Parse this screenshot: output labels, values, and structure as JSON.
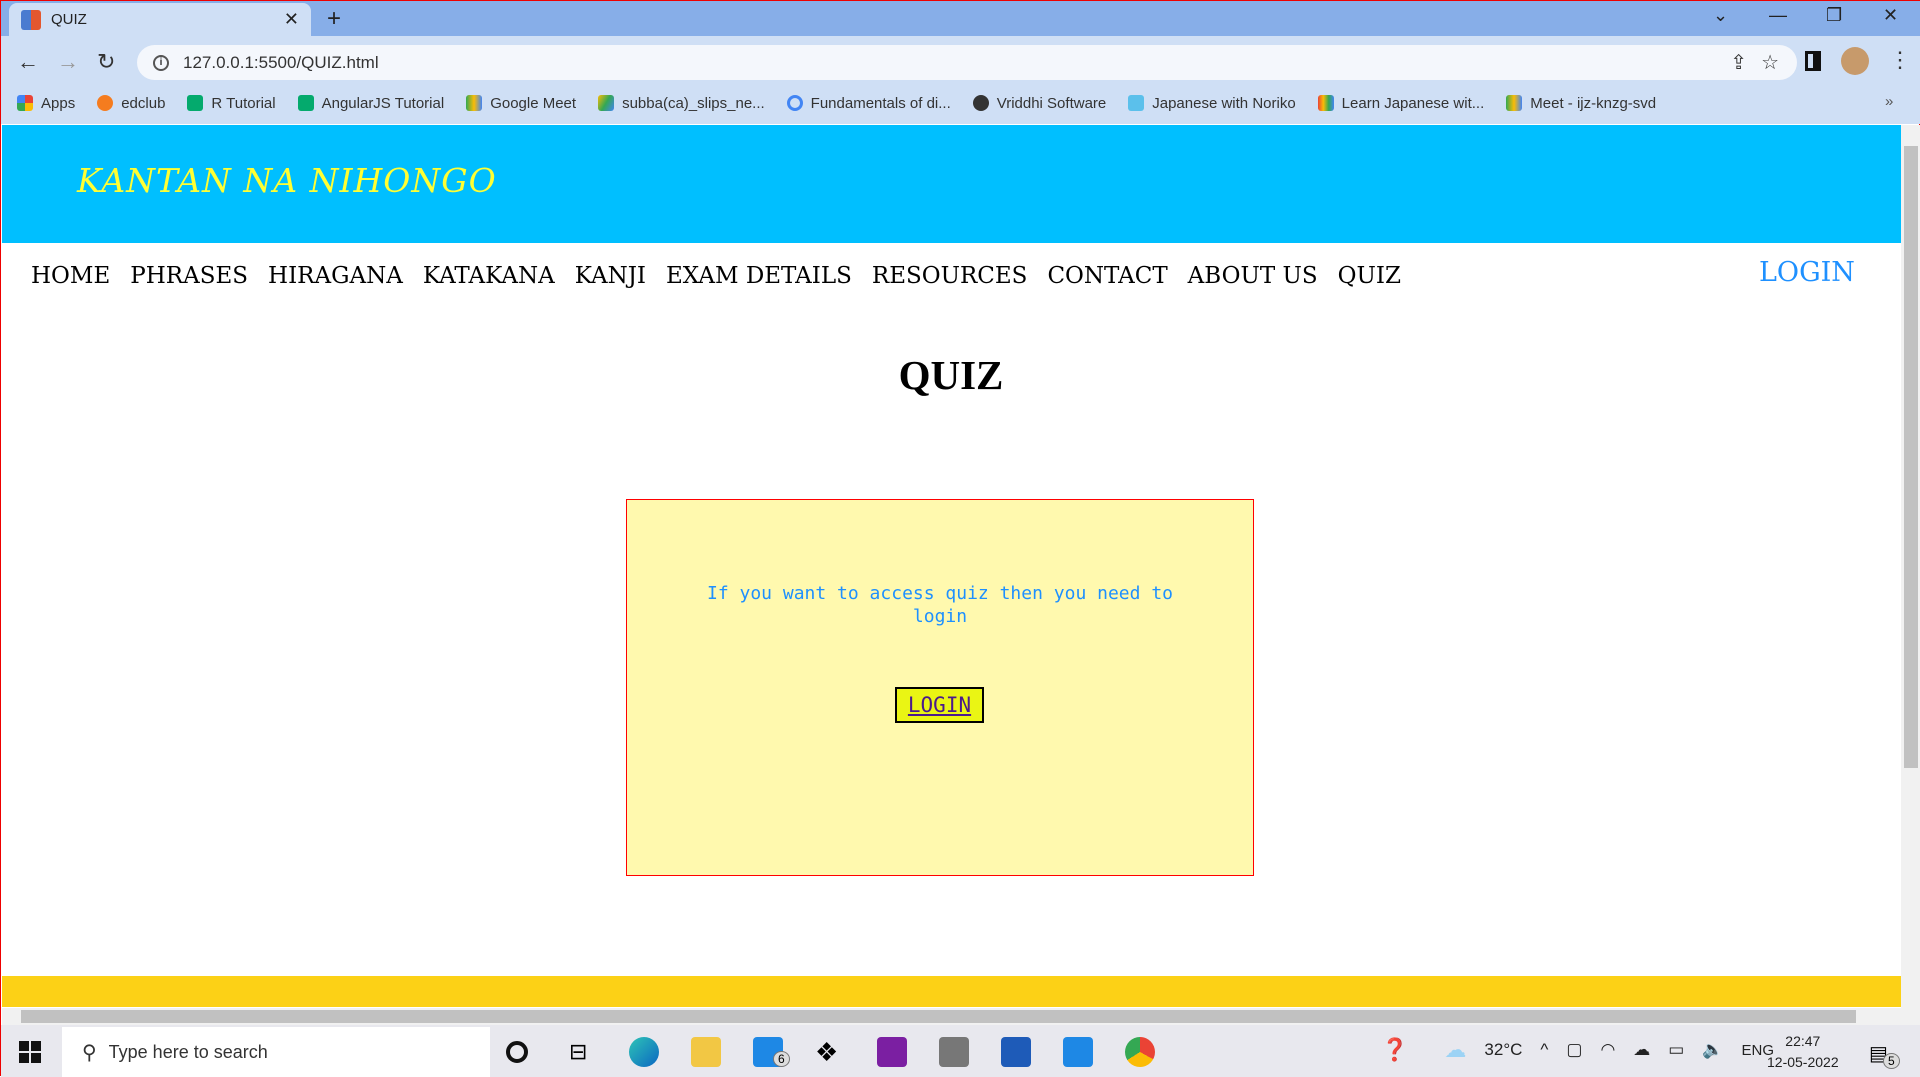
{
  "browser": {
    "tab_title": "QUIZ",
    "url": "127.0.0.1:5500/QUIZ.html",
    "bookmarks": [
      "Apps",
      "edclub",
      "R Tutorial",
      "AngularJS Tutorial",
      "Google Meet",
      "subba(ca)_slips_ne...",
      "Fundamentals of di...",
      "Vriddhi Software",
      "Japanese with Noriko",
      "Learn Japanese wit...",
      "Meet - ijz-knzg-svd"
    ],
    "more_bookmarks": "»"
  },
  "site": {
    "brand": "KANTAN NA NIHONGO",
    "nav": [
      "HOME",
      "PHRASES",
      "HIRAGANA",
      "KATAKANA",
      "KANJI",
      "EXAM DETAILS",
      "RESOURCES",
      "CONTACT",
      "ABOUT US",
      "QUIZ"
    ],
    "login": "LOGIN",
    "title": "QUIZ",
    "message": "If you want to access quiz then you need to login",
    "login_button": "LOGIN",
    "colors": {
      "header": "#00bfff",
      "brand": "#ffff33",
      "box": "#fff9ae",
      "footer": "#fcd116",
      "accent": "#1e90ff"
    }
  },
  "taskbar": {
    "search_placeholder": "Type here to search",
    "mail_badge": "6",
    "temperature": "32°C",
    "language": "ENG",
    "time": "22:47",
    "date": "12-05-2022",
    "notifications": "5"
  }
}
